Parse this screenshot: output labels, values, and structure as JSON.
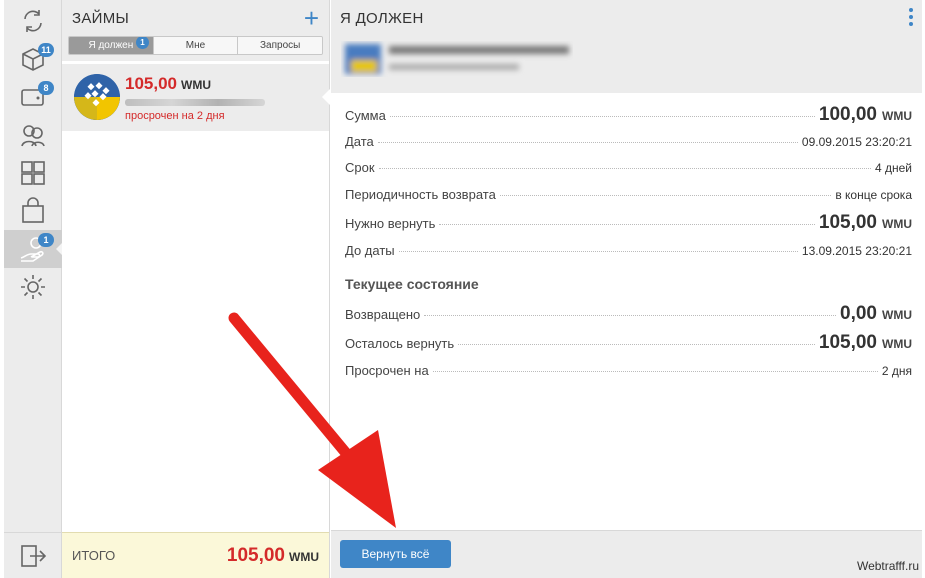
{
  "rail": {
    "items": [
      {
        "icon": "refresh-icon",
        "badge": ""
      },
      {
        "icon": "cube-icon",
        "badge": "11"
      },
      {
        "icon": "wallet-icon",
        "badge": "8"
      },
      {
        "icon": "contacts-icon",
        "badge": ""
      },
      {
        "icon": "services-grid-icon",
        "badge": ""
      },
      {
        "icon": "shopping-bag-icon",
        "badge": ""
      },
      {
        "icon": "loan-hand-icon",
        "badge": "1"
      },
      {
        "icon": "gear-icon",
        "badge": ""
      }
    ],
    "logout_icon": "logout-icon"
  },
  "list": {
    "title": "ЗАЙМЫ",
    "add_label": "+",
    "tabs": [
      {
        "label": "Я должен",
        "badge": "1"
      },
      {
        "label": "Мне",
        "badge": ""
      },
      {
        "label": "Запросы",
        "badge": ""
      }
    ],
    "item": {
      "amount": "105,00",
      "currency": "WMU",
      "status": "просрочен на 2 дня"
    },
    "total": {
      "label": "ИТОГО",
      "value": "105,00",
      "currency": "WMU"
    }
  },
  "detail": {
    "title": "Я ДОЛЖЕН",
    "rows": [
      {
        "label": "Сумма",
        "value": "100,00",
        "currency": "WMU"
      },
      {
        "label": "Дата",
        "value": "09.09.2015 23:20:21"
      },
      {
        "label": "Срок",
        "value": "4 дней"
      },
      {
        "label": "Периодичность возврата",
        "value": "в конце срока"
      },
      {
        "label": "Нужно вернуть",
        "value": "105,00",
        "currency": "WMU"
      },
      {
        "label": "До даты",
        "value": "13.09.2015 23:20:21"
      }
    ],
    "state_title": "Текущее состояние",
    "state_rows": [
      {
        "label": "Возвращено",
        "value": "0,00",
        "currency": "WMU"
      },
      {
        "label": "Осталось вернуть",
        "value": "105,00",
        "currency": "WMU"
      },
      {
        "label": "Просрочен на",
        "value": "2 дня"
      }
    ],
    "return_button": "Вернуть всё"
  },
  "watermark": "Webtrafff.ru",
  "colors": {
    "accent": "#3f86c7",
    "red": "#d42a2a",
    "green": "#2e8b2e",
    "arrow": "#e8231c"
  }
}
